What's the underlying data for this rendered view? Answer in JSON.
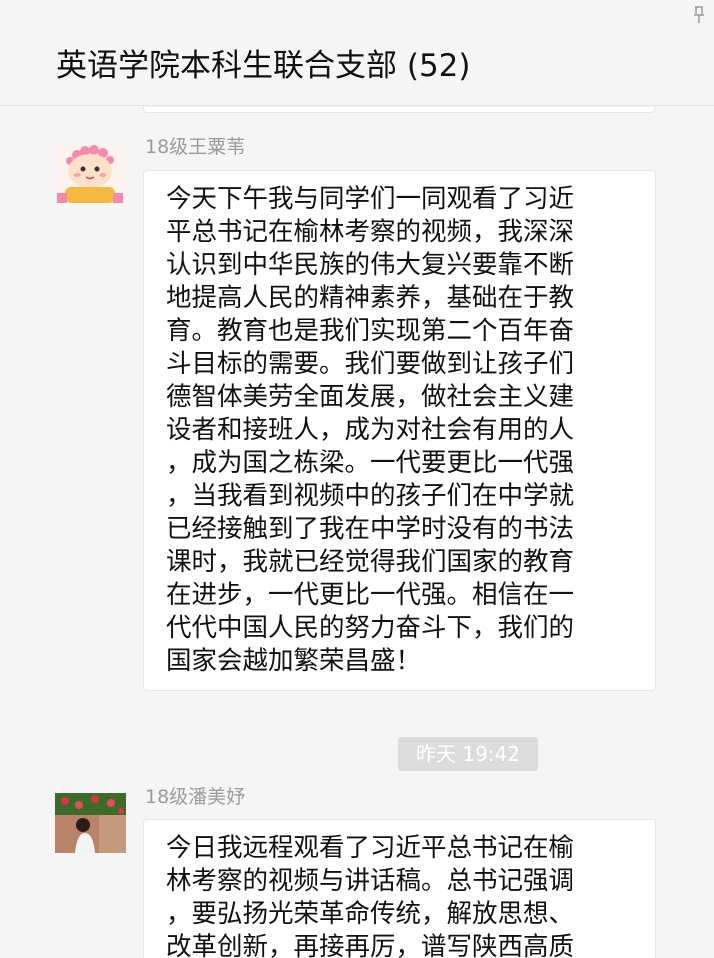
{
  "header": {
    "title": "英语学院本科生联合支部 (52)"
  },
  "messages": [
    {
      "sender": "18级王粟苇",
      "avatar_icon": "cartoon-girl-avatar-icon",
      "lines": [
        "今天下午我与同学们一同观看了习近",
        "平总书记在榆林考察的视频，我深深",
        "认识到中华民族的伟大复兴要靠不断",
        "地提高人民的精神素养，基础在于教",
        "育。教育也是我们实现第二个百年奋",
        "斗目标的需要。我们要做到让孩子们",
        "德智体美劳全面发展，做社会主义建",
        "设者和接班人，成为对社会有用的人",
        "，成为国之栋梁。一代要更比一代强",
        "，当我看到视频中的孩子们在中学就",
        "已经接触到了我在中学时没有的书法",
        "课时，我就已经觉得我们国家的教育",
        "在进步，一代更比一代强。相信在一",
        "代代中国人民的努力奋斗下，我们的",
        "国家会越加繁荣昌盛！"
      ]
    },
    {
      "sender": "18级潘美妤",
      "avatar_icon": "photo-avatar-icon",
      "lines": [
        "今日我远程观看了习近平总书记在榆",
        "林考察的视频与讲话稿。总书记强调",
        "，要弘扬光荣革命传统，解放思想、",
        "改革创新，再接再厉，谱写陕西高质"
      ]
    }
  ],
  "timestamp": "昨天 19:42",
  "colors": {
    "background": "#f5f5f5",
    "bubble": "#ffffff",
    "sender_name": "#9b9b9b",
    "time_badge_bg": "#dcdcdc"
  }
}
